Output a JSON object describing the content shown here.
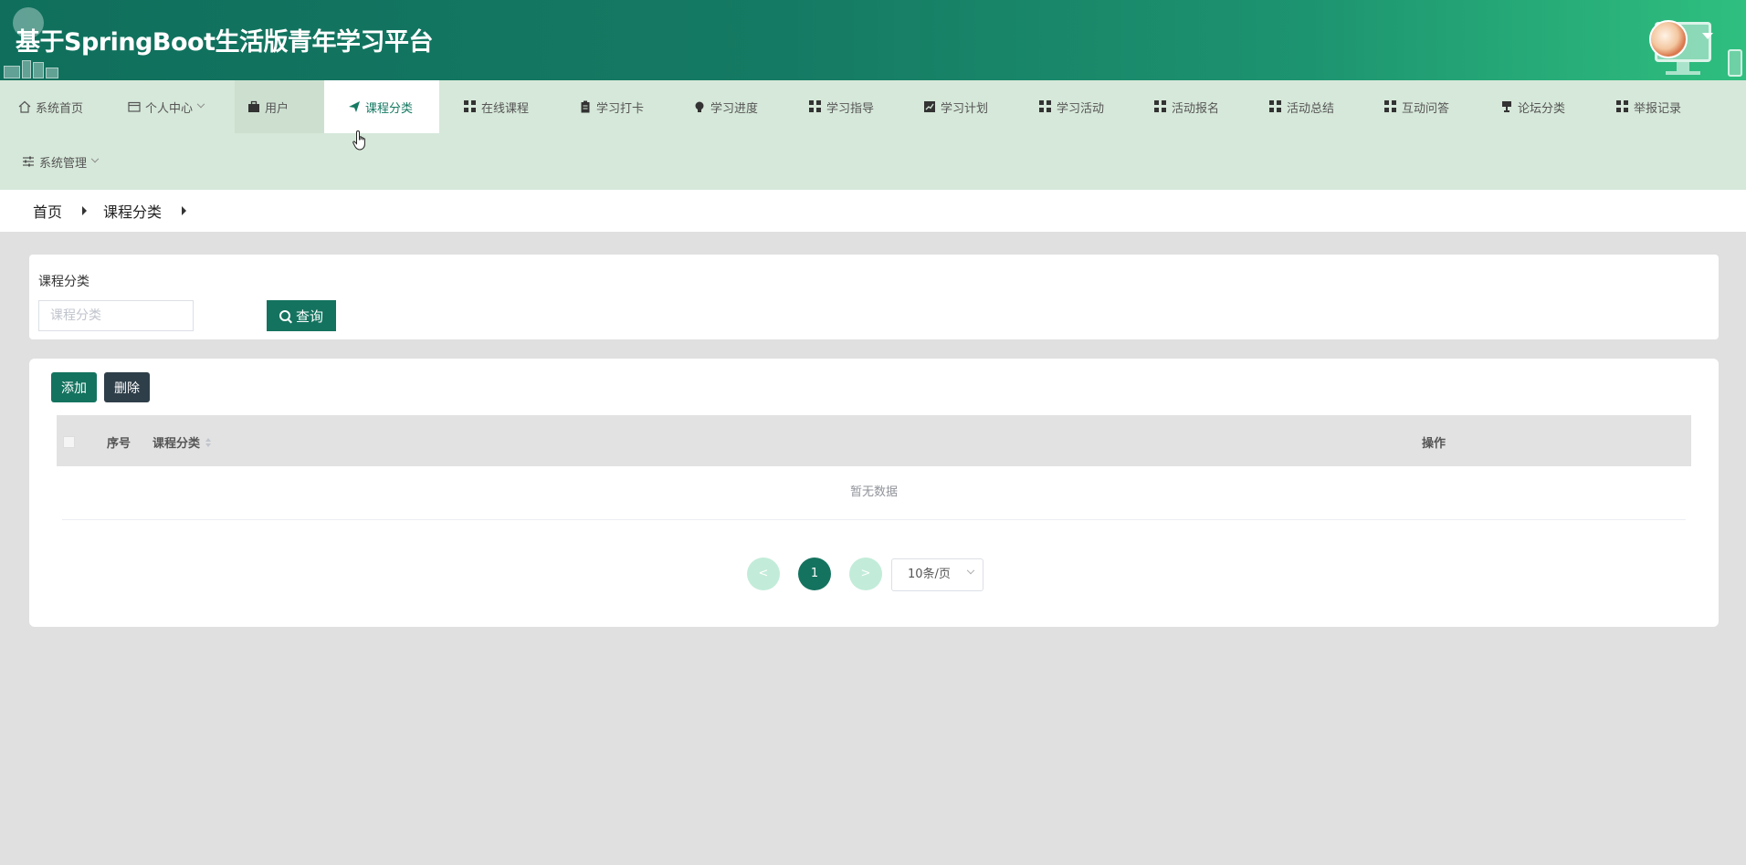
{
  "header": {
    "title": "基于SpringBoot生活版青年学习平台"
  },
  "nav": {
    "items": [
      {
        "label": "系统首页",
        "icon": "home-icon"
      },
      {
        "label": "个人中心",
        "icon": "wallet-icon"
      },
      {
        "label": "用户",
        "icon": "briefcase-icon"
      },
      {
        "label": "课程分类",
        "icon": "send-icon"
      },
      {
        "label": "在线课程",
        "icon": "grid-icon"
      },
      {
        "label": "学习打卡",
        "icon": "clipboard-icon"
      },
      {
        "label": "学习进度",
        "icon": "bulb-icon"
      },
      {
        "label": "学习指导",
        "icon": "grid-icon"
      },
      {
        "label": "学习计划",
        "icon": "chart-icon"
      },
      {
        "label": "学习活动",
        "icon": "grid-icon"
      },
      {
        "label": "活动报名",
        "icon": "grid-icon"
      },
      {
        "label": "活动总结",
        "icon": "grid-icon"
      },
      {
        "label": "互动问答",
        "icon": "grid-icon"
      },
      {
        "label": "论坛分类",
        "icon": "trophy-icon"
      },
      {
        "label": "举报记录",
        "icon": "grid-icon"
      },
      {
        "label": "系统管理",
        "icon": "sliders-icon"
      }
    ]
  },
  "breadcrumb": {
    "home": "首页",
    "current": "课程分类"
  },
  "search": {
    "label": "课程分类",
    "placeholder": "课程分类",
    "button": "查询"
  },
  "table": {
    "add_label": "添加",
    "delete_label": "删除",
    "columns": [
      "序号",
      "课程分类",
      "操作"
    ],
    "empty_text": "暂无数据"
  },
  "pagination": {
    "prev": "<",
    "current_page": "1",
    "next": ">",
    "page_size": "10条/页"
  },
  "colors": {
    "primary": "#14735f",
    "nav_bg": "#d6e8d9",
    "header_start": "#0f6f5c",
    "header_end": "#2fbf7f"
  }
}
